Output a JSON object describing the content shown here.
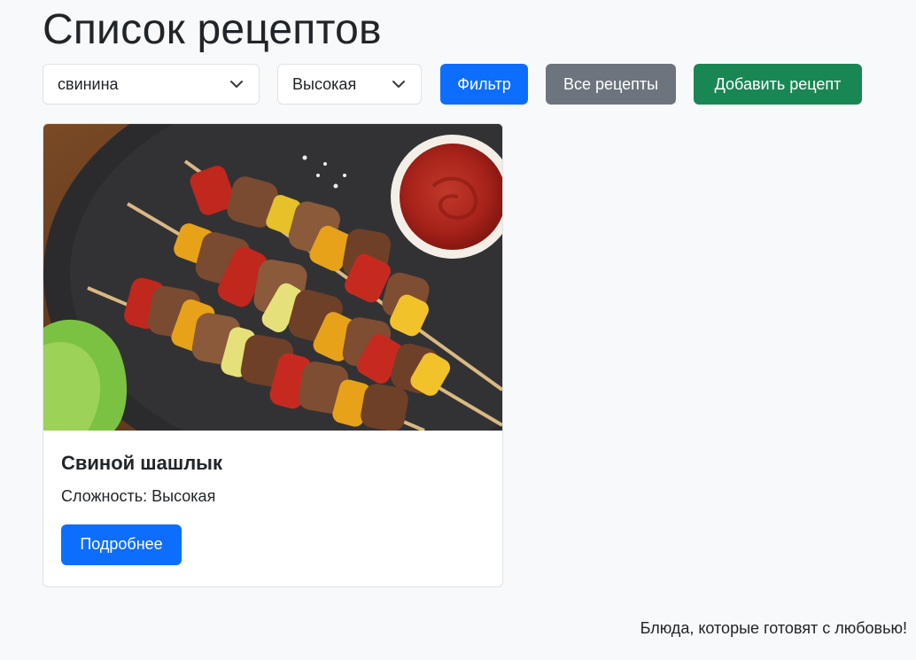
{
  "header": {
    "title": "Список рецептов"
  },
  "filters": {
    "ingredient": {
      "value": "свинина"
    },
    "difficulty": {
      "value": "Высокая"
    },
    "filter_button": "Фильтр",
    "all_button": "Все рецепты",
    "add_button": "Добавить рецепт"
  },
  "recipes": [
    {
      "title": "Свиной шашлык",
      "difficulty_text": "Сложность: Высокая",
      "details_button": "Подробнее",
      "image_icon": "kebab-photo"
    }
  ],
  "footer": {
    "text": "Блюда, которые готовят с любовью!"
  },
  "colors": {
    "primary": "#0d6efd",
    "secondary": "#6c757d",
    "success": "#198754",
    "background": "#f8f9fa"
  }
}
